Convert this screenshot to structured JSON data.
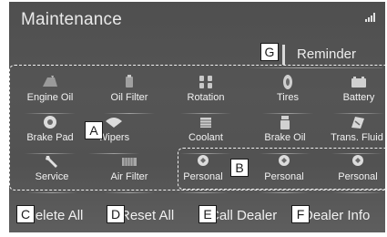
{
  "screen": {
    "title": "Maintenance",
    "reminder_label": "Reminder"
  },
  "items": [
    {
      "label": "Engine Oil",
      "icon": "engine-oil-icon"
    },
    {
      "label": "Oil Filter",
      "icon": "oil-filter-icon"
    },
    {
      "label": "Rotation",
      "icon": "tire-rotation-icon"
    },
    {
      "label": "Tires",
      "icon": "tire-icon"
    },
    {
      "label": "Battery",
      "icon": "battery-icon"
    },
    {
      "label": "Brake Pad",
      "icon": "brake-pad-icon"
    },
    {
      "label": "Wipers",
      "icon": "wiper-icon"
    },
    {
      "label": "Coolant",
      "icon": "coolant-icon"
    },
    {
      "label": "Brake Oil",
      "icon": "brake-oil-icon"
    },
    {
      "label": "Trans. Fluid",
      "icon": "trans-fluid-icon"
    },
    {
      "label": "Service",
      "icon": "wrench-icon"
    },
    {
      "label": "Air Filter",
      "icon": "air-filter-icon"
    },
    {
      "label": "Personal",
      "icon": "personal-icon"
    },
    {
      "label": "Personal",
      "icon": "personal-icon"
    },
    {
      "label": "Personal",
      "icon": "personal-icon"
    }
  ],
  "bottom_buttons": {
    "delete_all": "Delete All",
    "reset_all": "Reset All",
    "call_dealer": "Call Dealer",
    "dealer_info": "Dealer Info"
  },
  "callouts": {
    "a": "A",
    "b": "B",
    "c": "C",
    "d": "D",
    "e": "E",
    "f": "F",
    "g": "G"
  }
}
